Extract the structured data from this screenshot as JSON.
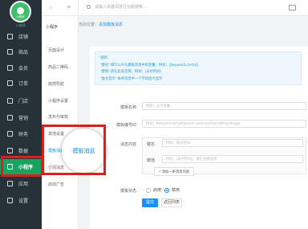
{
  "logo": {
    "text": "小程序",
    "caption": "小程序"
  },
  "sidebar": {
    "items": [
      {
        "label": "店铺",
        "icon": "store-icon"
      },
      {
        "label": "商品",
        "icon": "goods-icon"
      },
      {
        "label": "会员",
        "icon": "member-icon"
      },
      {
        "label": "订单",
        "icon": "order-icon"
      },
      {
        "label": "门店",
        "icon": "shop-icon"
      },
      {
        "label": "营销",
        "icon": "marketing-icon"
      },
      {
        "label": "财务",
        "icon": "finance-icon"
      },
      {
        "label": "数据",
        "icon": "data-icon"
      },
      {
        "label": "小程序",
        "icon": "miniapp-icon"
      },
      {
        "label": "应用",
        "icon": "app-icon"
      },
      {
        "label": "设置",
        "icon": "settings-icon"
      }
    ],
    "active_index": 8
  },
  "subnav": {
    "home_icon": "⌂",
    "menu_icon": "≡",
    "heading": "小程序",
    "items": [
      "页面设计",
      "商品二维码",
      "底部导航",
      "小程序设置",
      "发布与审核",
      "其他设置",
      "模板消息",
      "订阅消息",
      "启动广告"
    ],
    "current": "模板消息"
  },
  "zoom_label": "模板消息",
  "topbar": {
    "search_placeholder": "请输入关键词进行功能搜索..."
  },
  "breadcrumb": {
    "prefix": "当前位置：",
    "current": "添加模板消息"
  },
  "tips": {
    "title": "说明：",
    "lines": [
      "\"键名\" 填写公众号模板消息中的变量，例如：{{keyword1.DATA}}",
      "\"键值\" 请在此处选择，例如：{支付时间}",
      "\"放大显示\" 每条消息中一个字段放大显示"
    ]
  },
  "form": {
    "template_name_label": "模板名称",
    "template_name_placeholder": "例如：支付提醒",
    "template_id_label": "模板编号ID",
    "template_id_placeholder": "例如：RMsLRSmW7wfhjmZ14r-owGmuVrf3WYMPFpDPXg4I",
    "content_label": "消息内容",
    "key_name_label": "键名",
    "key_name_placeholder": "例如：购买时间",
    "key_value_label": "键值",
    "key_value_placeholder": "例如：{支付时间}，请在右侧选择",
    "add_field_label": "+ 添加一条消息内容",
    "status_label": "模板状态",
    "status_options": [
      "启用",
      "禁用"
    ],
    "status_selected": "禁用",
    "submit_label": "提交",
    "back_label": "返回列表"
  }
}
